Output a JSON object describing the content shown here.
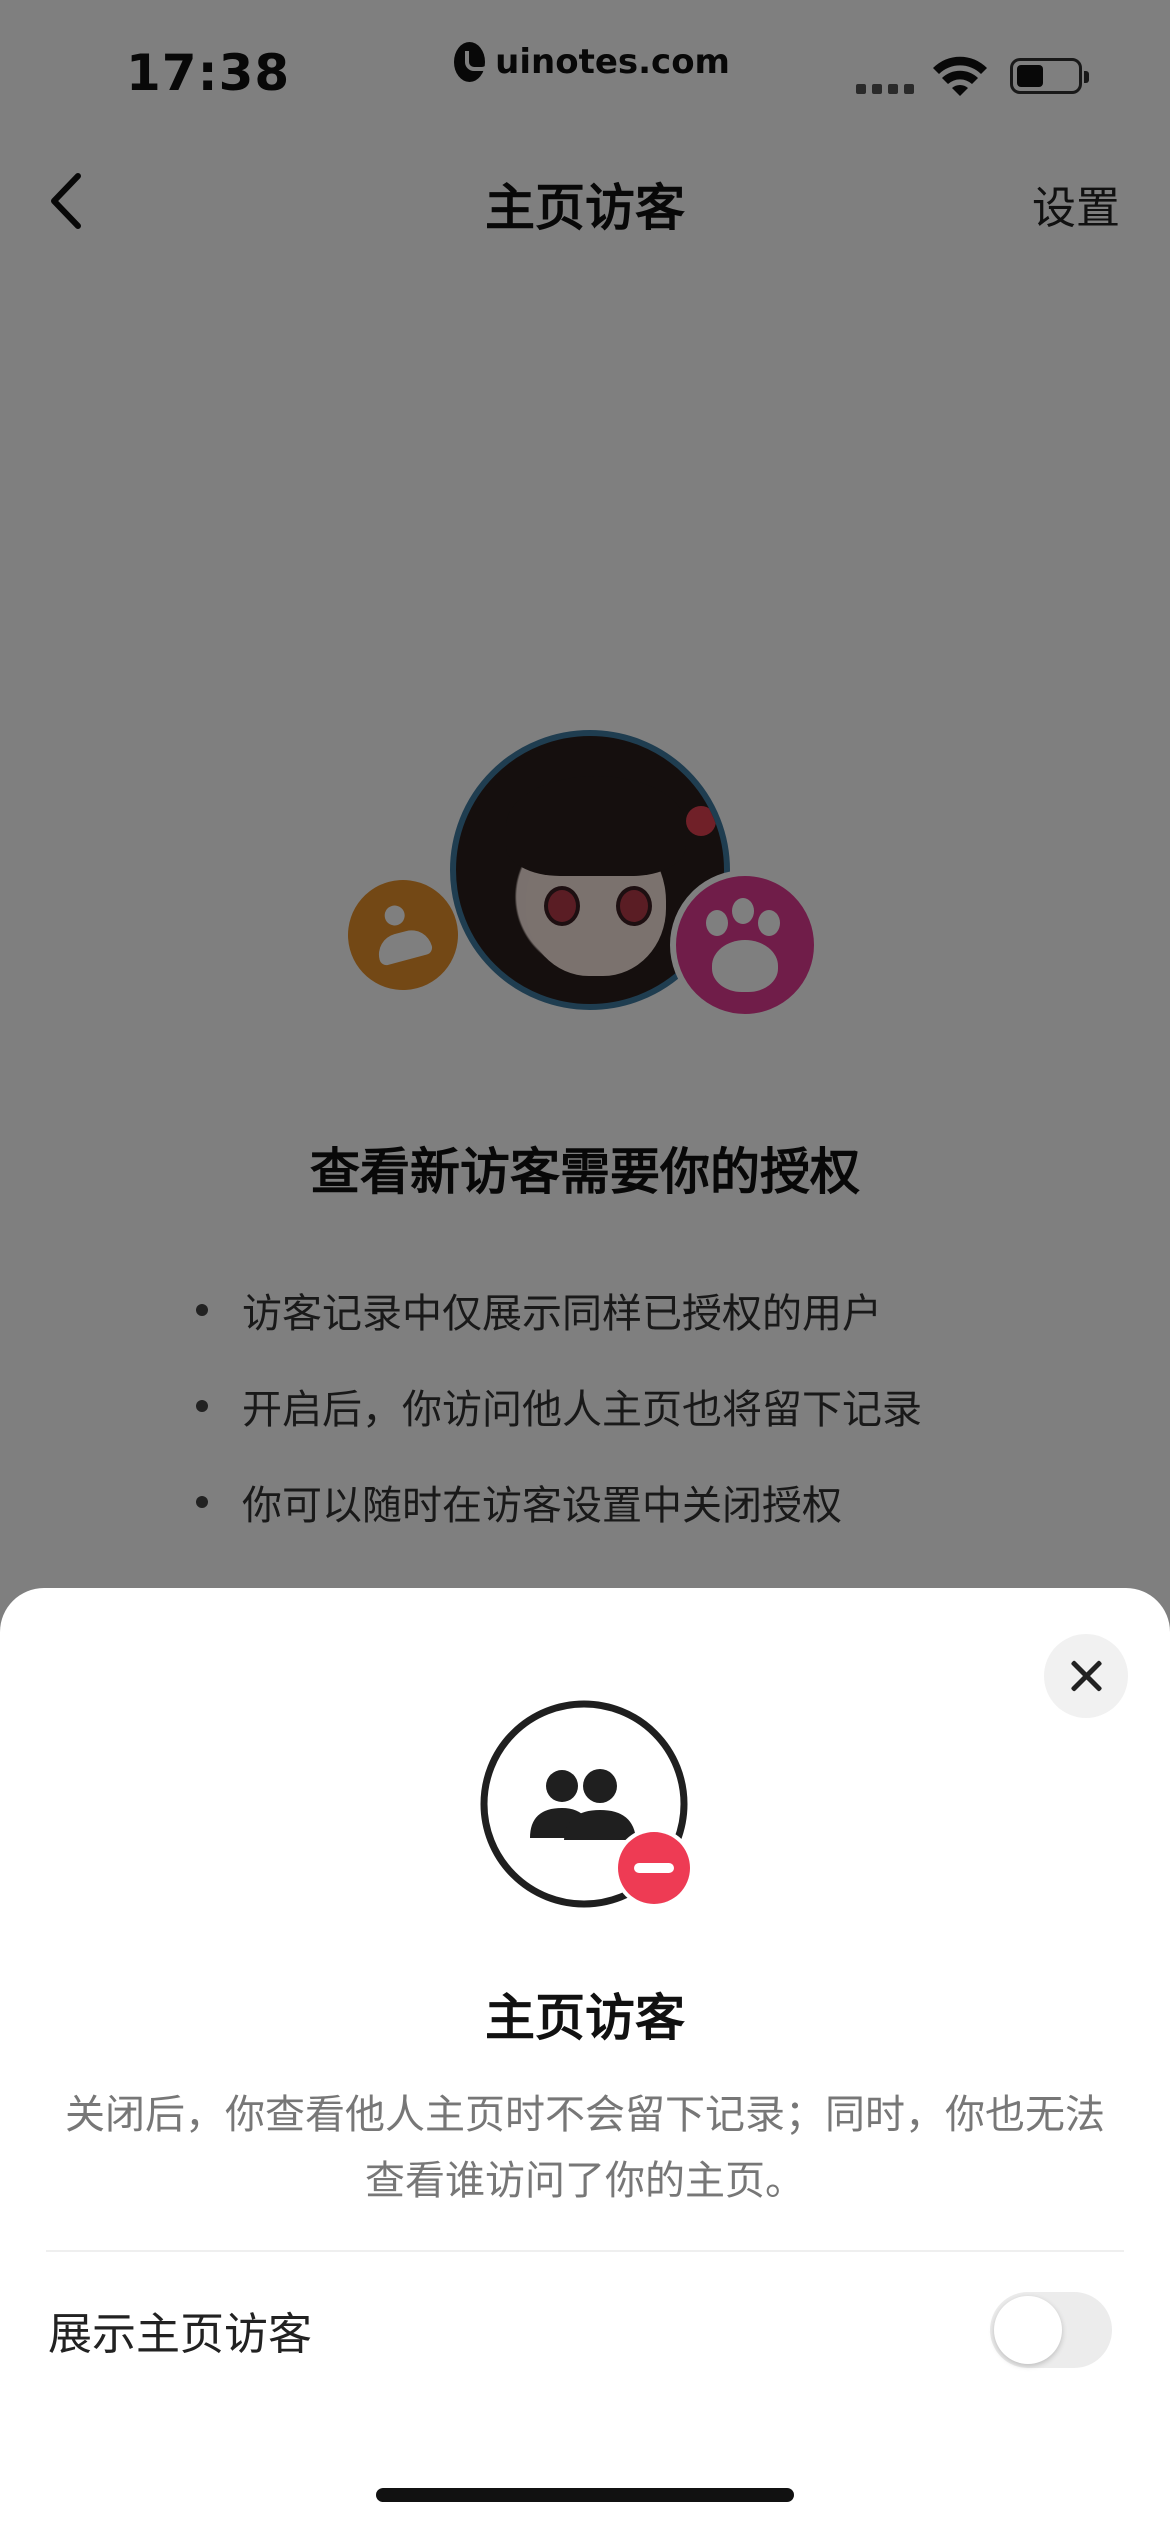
{
  "status_bar": {
    "time": "17:38",
    "url": "uinotes.com"
  },
  "nav": {
    "title": "主页访客",
    "settings_label": "设置"
  },
  "auth": {
    "title": "查看新访客需要你的授权",
    "bullets": [
      "访客记录中仅展示同样已授权的用户",
      "开启后，你访问他人主页也将留下记录",
      "你可以随时在访客设置中关闭授权"
    ]
  },
  "sheet": {
    "title": "主页访客",
    "description": "关闭后，你查看他人主页时不会留下记录；同时，你也无法查看谁访问了你的主页。",
    "toggle_label": "展示主页访客",
    "toggle_on": false
  },
  "colors": {
    "accent_red": "#ee3b54",
    "paw_pink": "#e03a92",
    "bubble_orange": "#e6902a"
  }
}
